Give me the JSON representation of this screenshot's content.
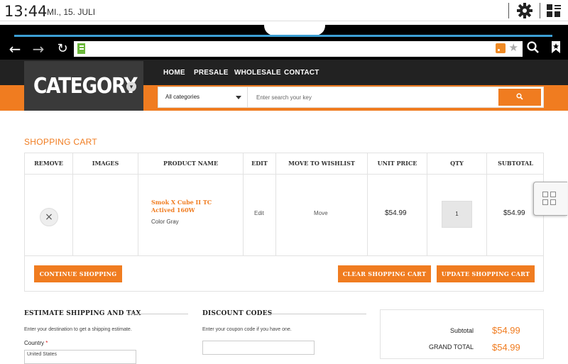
{
  "status_bar": {
    "time": "13:44",
    "date": "MI., 15. JULI",
    "icons": [
      "settings-gear-icon",
      "quick-settings-icon"
    ]
  },
  "browser": {
    "nav_icons": [
      "back-arrow-icon",
      "forward-arrow-icon",
      "reload-icon",
      "search-icon",
      "bookmark-icon"
    ],
    "url_bar_icons": [
      "site-favicon",
      "rss-icon",
      "star-icon"
    ]
  },
  "header": {
    "category_title": "CATEGORY",
    "menu": [
      "HOME",
      "PRESALE",
      "WHOLESALE",
      "CONTACT"
    ],
    "search": {
      "category_selected": "All categories",
      "placeholder": "Enter search your key",
      "button_icon": "search-icon"
    }
  },
  "page": {
    "title": "SHOPPING CART"
  },
  "cart": {
    "columns": [
      "REMOVE",
      "IMAGES",
      "PRODUCT NAME",
      "EDIT",
      "MOVE TO WISHLIST",
      "UNIT PRICE",
      "QTY",
      "SUBTOTAL"
    ],
    "items": [
      {
        "product_name": "Smok X Cube II TC Actived 160W",
        "option": "Color  Gray",
        "edit_label": "Edit",
        "move_label": "Move",
        "unit_price": "$54.99",
        "qty": "1",
        "subtotal": "$54.99"
      }
    ],
    "buttons": {
      "continue": "CONTINUE SHOPPING",
      "clear": "CLEAR SHOPPING CART",
      "update": "UPDATE SHOPPING CART"
    }
  },
  "shipping": {
    "title": "ESTIMATE SHIPPING AND TAX",
    "description": "Enter your destination to get a shipping estimate.",
    "country_label": "Country",
    "country_required_mark": "*",
    "country_value": "United States"
  },
  "discount": {
    "title": "DISCOUNT CODES",
    "description": "Enter your coupon code if you have one."
  },
  "totals": {
    "subtotal_label": "Subtotal",
    "subtotal_value": "$54.99",
    "grand_total_label": "GRAND TOTAL",
    "grand_total_value": "$54.99"
  }
}
